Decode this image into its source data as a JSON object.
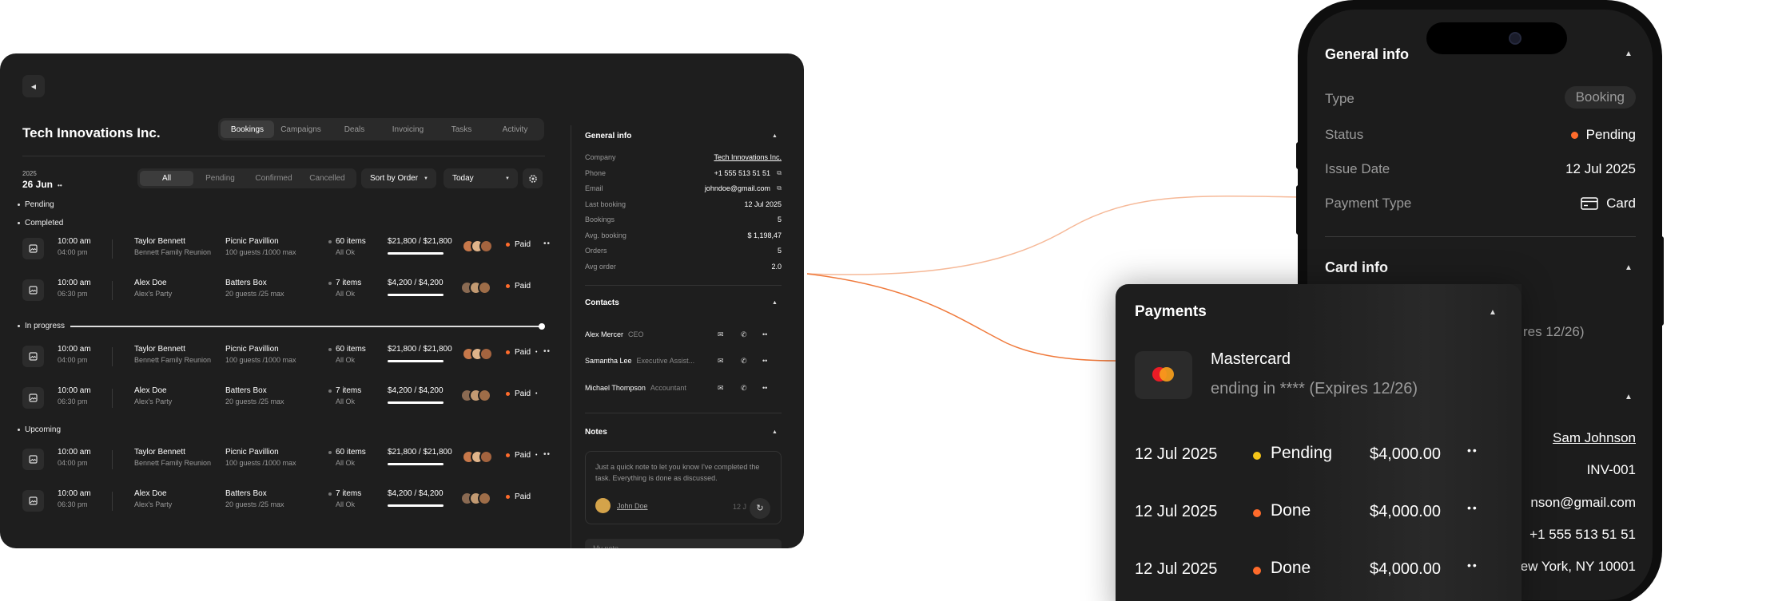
{
  "desktop": {
    "company": "Tech Innovations Inc.",
    "tabs": [
      "Bookings",
      "Campaigns",
      "Deals",
      "Invoicing",
      "Tasks",
      "Activity"
    ],
    "date_year": "2025",
    "date_day": "26 Jun",
    "filters": [
      "All",
      "Pending",
      "Confirmed",
      "Cancelled"
    ],
    "sort_label": "Sort by Order",
    "range_label": "Today",
    "groups": {
      "pending": "Pending",
      "completed": "Completed",
      "in_progress": "In progress",
      "upcoming": "Upcoming"
    },
    "rows": [
      {
        "t1": "10:00 am",
        "t2": "04:00 pm",
        "name": "Taylor Bennett",
        "event": "Bennett Family Reunion",
        "venue": "Picnic Pavillion",
        "guests": "100 guests  /1000 max",
        "items": "60 items",
        "ok": "All Ok",
        "amount": "$21,800 / $21,800",
        "status": "Paid"
      },
      {
        "t1": "10:00 am",
        "t2": "06:30 pm",
        "name": "Alex Doe",
        "event": "Alex's Party",
        "venue": "Batters Box",
        "guests": "20 guests  /25 max",
        "items": "7 items",
        "ok": "All Ok",
        "amount": "$4,200 / $4,200",
        "status": "Paid"
      },
      {
        "t1": "10:00 am",
        "t2": "04:00 pm",
        "name": "Taylor Bennett",
        "event": "Bennett Family Reunion",
        "venue": "Picnic Pavillion",
        "guests": "100 guests  /1000 max",
        "items": "60 items",
        "ok": "All Ok",
        "amount": "$21,800 / $21,800",
        "status": "Paid"
      },
      {
        "t1": "10:00 am",
        "t2": "06:30 pm",
        "name": "Alex Doe",
        "event": "Alex's Party",
        "venue": "Batters Box",
        "guests": "20 guests  /25 max",
        "items": "7 items",
        "ok": "All Ok",
        "amount": "$4,200 / $4,200",
        "status": "Paid"
      },
      {
        "t1": "10:00 am",
        "t2": "04:00 pm",
        "name": "Taylor Bennett",
        "event": "Bennett Family Reunion",
        "venue": "Picnic Pavillion",
        "guests": "100 guests  /1000 max",
        "items": "60 items",
        "ok": "All Ok",
        "amount": "$21,800 / $21,800",
        "status": "Paid"
      },
      {
        "t1": "10:00 am",
        "t2": "06:30 pm",
        "name": "Alex Doe",
        "event": "Alex's Party",
        "venue": "Batters Box",
        "guests": "20 guests  /25 max",
        "items": "7 items",
        "ok": "All Ok",
        "amount": "$4,200 / $4,200",
        "status": "Paid"
      }
    ],
    "general_info": {
      "title": "General info",
      "items": [
        {
          "k": "Company",
          "v": "Tech Innovations Inc."
        },
        {
          "k": "Phone",
          "v": "+1 555 513 51 51"
        },
        {
          "k": "Email",
          "v": "johndoe@gmail.com"
        },
        {
          "k": "Last booking",
          "v": "12 Jul 2025"
        },
        {
          "k": "Bookings",
          "v": "5"
        },
        {
          "k": "Avg. booking",
          "v": "$ 1,198,47"
        },
        {
          "k": "Orders",
          "v": "5"
        },
        {
          "k": "Avg order",
          "v": "2.0"
        }
      ]
    },
    "contacts": {
      "title": "Contacts",
      "items": [
        {
          "name": "Alex Mercer",
          "role": "CEO"
        },
        {
          "name": "Samantha Lee",
          "role": "Executive Assist..."
        },
        {
          "name": "Michael Thompson",
          "role": "Accountant"
        }
      ]
    },
    "notes": {
      "title": "Notes",
      "text": "Just a quick note to let you know I've completed the task. Everything is done as discussed.",
      "author": "John Doe",
      "time": "12 J",
      "placeholder": "My note"
    }
  },
  "phone": {
    "general_title": "General info",
    "rows": [
      {
        "k": "Type",
        "v": "Booking"
      },
      {
        "k": "Status",
        "v": "Pending"
      },
      {
        "k": "Issue Date",
        "v": "12 Jul 2025"
      },
      {
        "k": "Payment Type",
        "v": "Card"
      }
    ],
    "card_title": "Card info",
    "card_expires_partial": "res 12/26)",
    "contact_name": "Sam Johnson",
    "invoice": "INV-001",
    "email_partial": "nson@gmail.com",
    "phone": "+1 555 513 51 51",
    "address_partial": "ew York, NY 10001"
  },
  "payments": {
    "title": "Payments",
    "card_name": "Mastercard",
    "card_sub": "ending in **** (Expires 12/26)",
    "rows": [
      {
        "date": "12 Jul 2025",
        "status": "Pending",
        "amount": "$4,000.00",
        "color": "#f5c518"
      },
      {
        "date": "12 Jul 2025",
        "status": "Done",
        "amount": "$4,000.00",
        "color": "#ff6b2b"
      },
      {
        "date": "12 Jul 2025",
        "status": "Done",
        "amount": "$4,000.00",
        "color": "#ff6b2b"
      }
    ]
  },
  "colors": {
    "accent_orange": "#ff6b2b",
    "pending_yellow": "#f5c518",
    "panel_bg": "#1e1e1e"
  }
}
